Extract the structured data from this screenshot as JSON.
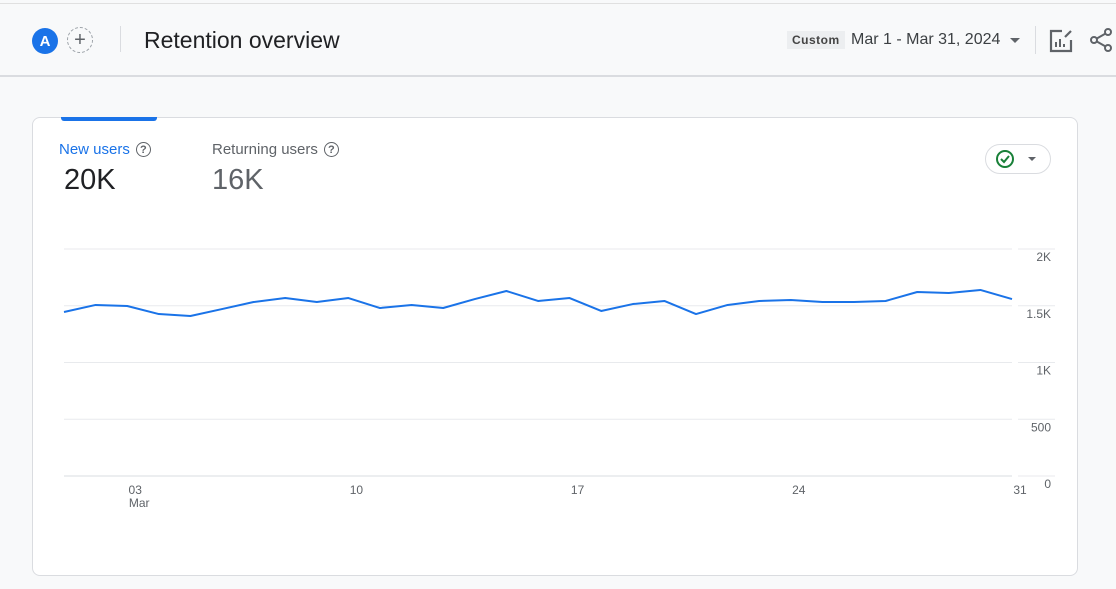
{
  "header": {
    "avatar_letter": "A",
    "page_title": "Retention overview",
    "date_preset": "Custom",
    "date_range": "Mar 1 - Mar 31, 2024",
    "icons": [
      "add-comparison-icon",
      "customize-report-icon",
      "share-icon"
    ]
  },
  "card": {
    "metrics": [
      {
        "label": "New users",
        "value": "20K",
        "selected": true
      },
      {
        "label": "Returning users",
        "value": "16K",
        "selected": false
      }
    ],
    "status_icon": "check-circle-icon"
  },
  "colors": {
    "accent": "#1a73e8",
    "line": "#1a73e8",
    "check": "#188038"
  },
  "chart_data": {
    "type": "line",
    "series": [
      {
        "name": "New users",
        "values": [
          1445,
          1507,
          1498,
          1427,
          1410,
          1471,
          1533,
          1568,
          1533,
          1568,
          1480,
          1507,
          1480,
          1559,
          1630,
          1542,
          1568,
          1454,
          1515,
          1542,
          1427,
          1507,
          1542,
          1551,
          1533,
          1533,
          1542,
          1621,
          1612,
          1639,
          1559
        ]
      }
    ],
    "x": [
      1,
      2,
      3,
      4,
      5,
      6,
      7,
      8,
      9,
      10,
      11,
      12,
      13,
      14,
      15,
      16,
      17,
      18,
      19,
      20,
      21,
      22,
      23,
      24,
      25,
      26,
      27,
      28,
      29,
      30,
      31
    ],
    "x_ticks": [
      {
        "day": 3,
        "label": "03",
        "sublabel": "Mar"
      },
      {
        "day": 10,
        "label": "10"
      },
      {
        "day": 17,
        "label": "17"
      },
      {
        "day": 24,
        "label": "24"
      },
      {
        "day": 31,
        "label": "31"
      }
    ],
    "y_ticks": [
      {
        "value": 0,
        "label": "0"
      },
      {
        "value": 500,
        "label": "500"
      },
      {
        "value": 1000,
        "label": "1K"
      },
      {
        "value": 1500,
        "label": "1.5K"
      },
      {
        "value": 2000,
        "label": "2K"
      }
    ],
    "ylim": [
      0,
      2000
    ],
    "grid": true,
    "y_axis_side": "right"
  }
}
